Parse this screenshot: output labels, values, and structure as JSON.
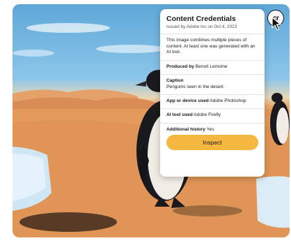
{
  "card": {
    "title": "Content Credentials",
    "issued": "Issued by Adobe Inc on Oct 4, 2023",
    "description": "This image combines multiple pieces of content. At least one was generated with an AI tool.",
    "produced_by_label": "Produced by",
    "produced_by_value": "Benoit Lemoine",
    "caption_label": "Caption",
    "caption_value": "Penguins seen in the desert.",
    "app_label": "App or device used",
    "app_value": "Adobe Photoshop",
    "ai_tool_label": "AI tool used",
    "ai_tool_value": "Adobe Firefly",
    "history_label": "Additional history",
    "history_value": "Yes",
    "inspect_label": "Inspect"
  },
  "badge": {
    "text": "cr",
    "icon": "content-credentials-icon"
  },
  "colors": {
    "accent": "#f4b740",
    "sky": "#6fb3e0",
    "sand": "#e39a5c"
  }
}
